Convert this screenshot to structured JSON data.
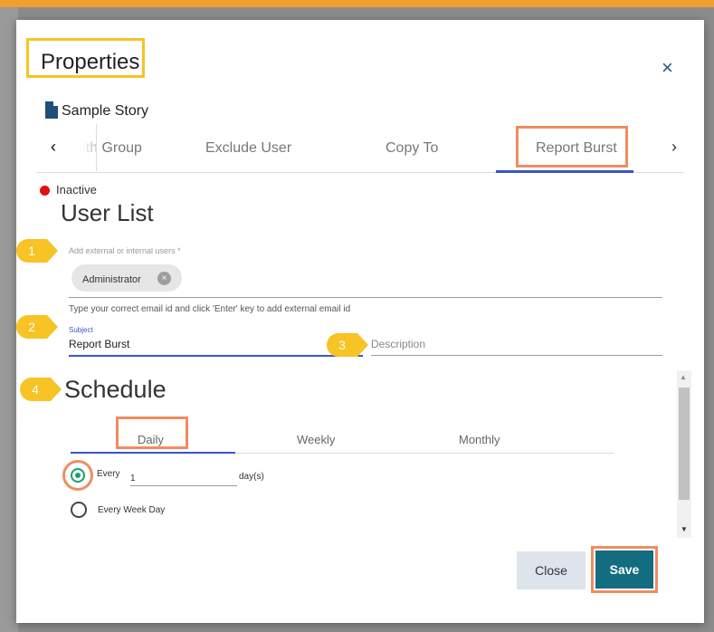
{
  "dialog": {
    "title": "Properties",
    "close_icon": "×",
    "story_name": "Sample Story"
  },
  "tabs": {
    "prev_icon": "‹",
    "next_icon": "›",
    "items": [
      "With Group",
      "Exclude User",
      "Copy To",
      "Report Burst"
    ],
    "active": "Report Burst"
  },
  "status": {
    "label": "Inactive",
    "color": "#e10f0f"
  },
  "user_list": {
    "heading": "User List",
    "field_label": "Add external or internal users *",
    "chip": "Administrator",
    "chip_remove_icon": "×",
    "hint": "Type your correct email id and click 'Enter' key to add external email id"
  },
  "subject": {
    "label": "Subject",
    "value": "Report Burst"
  },
  "description": {
    "placeholder": "Description"
  },
  "badges": [
    "1",
    "2",
    "3",
    "4"
  ],
  "schedule": {
    "heading": "Schedule",
    "tabs": [
      "Daily",
      "Weekly",
      "Monthly"
    ],
    "active_tab": "Daily",
    "every_label": "Every",
    "every_value": "1",
    "days_suffix": "day(s)",
    "every_week_day": "Every Week Day"
  },
  "scrollbar": {
    "up_icon": "▲",
    "down_icon": "▼"
  },
  "buttons": {
    "close": "Close",
    "save": "Save"
  },
  "colors": {
    "highlight_yellow": "#f7c325",
    "highlight_orange": "#f28c5e",
    "accent_blue": "#3b55c6",
    "save_bg": "#146c80"
  }
}
